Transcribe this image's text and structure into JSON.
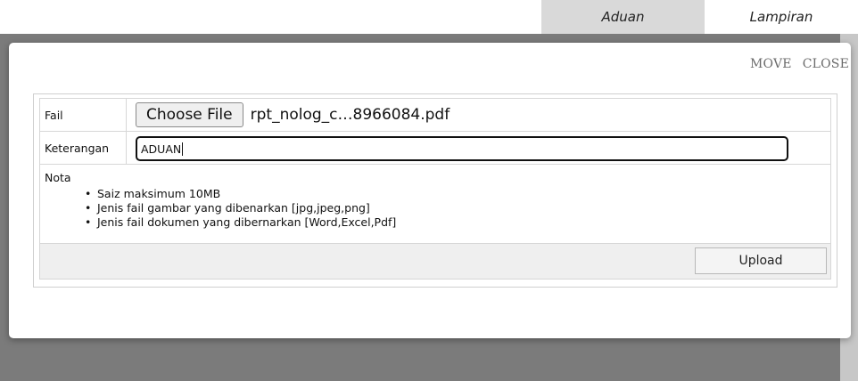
{
  "tabs": [
    {
      "label": "Aduan"
    },
    {
      "label": "Lampiran"
    }
  ],
  "dialog": {
    "move_label": "MOVE",
    "close_label": "CLOSE"
  },
  "form": {
    "fail_label": "Fail",
    "choose_file_label": "Choose File",
    "selected_file": "rpt_nolog_c…8966084.pdf",
    "keterangan_label": "Keterangan",
    "keterangan_value": "ADUAN",
    "nota_label": "Nota",
    "nota_items": [
      "Saiz maksimum 10MB",
      "Jenis fail gambar yang dibenarkan [jpg,jpeg,png]",
      "Jenis fail dokumen yang dibernarkan [Word,Excel,Pdf]"
    ],
    "upload_label": "Upload"
  }
}
